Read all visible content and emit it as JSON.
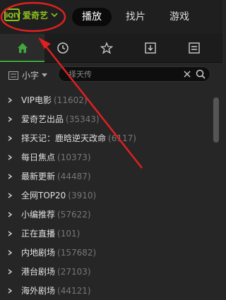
{
  "header": {
    "logo_badge": "iQIY",
    "brand": "爱奇艺",
    "tabs": [
      {
        "label": "播放",
        "active": true
      },
      {
        "label": "找片"
      },
      {
        "label": "游戏"
      }
    ]
  },
  "icon_tabs": [
    {
      "icon": "home-icon",
      "active": true
    },
    {
      "icon": "clock-icon"
    },
    {
      "icon": "star-icon"
    },
    {
      "icon": "download-icon"
    },
    {
      "icon": "list-icon"
    }
  ],
  "filter": {
    "size_label": "小字",
    "search_value": "择天传"
  },
  "list": [
    {
      "label": "VIP电影",
      "count": "(11602)"
    },
    {
      "label": "爱奇艺出品",
      "count": "(35343)"
    },
    {
      "label": "择天记：鹿晗逆天改命",
      "count": "(6117)"
    },
    {
      "label": "每日焦点",
      "count": "(10373)"
    },
    {
      "label": "最新更新",
      "count": "(44487)"
    },
    {
      "label": "全网TOP20",
      "count": "(3910)"
    },
    {
      "label": "小编推荐",
      "count": "(57622)"
    },
    {
      "label": "正在直播",
      "count": "(101)"
    },
    {
      "label": "内地剧场",
      "count": "(157682)"
    },
    {
      "label": "港台剧场",
      "count": "(27103)"
    },
    {
      "label": "海外剧场",
      "count": "(44121)"
    }
  ],
  "colors": {
    "brand_green": "#8dc21f",
    "active_tab_underline": "#3fa83f",
    "annotation_red": "#e02020"
  }
}
